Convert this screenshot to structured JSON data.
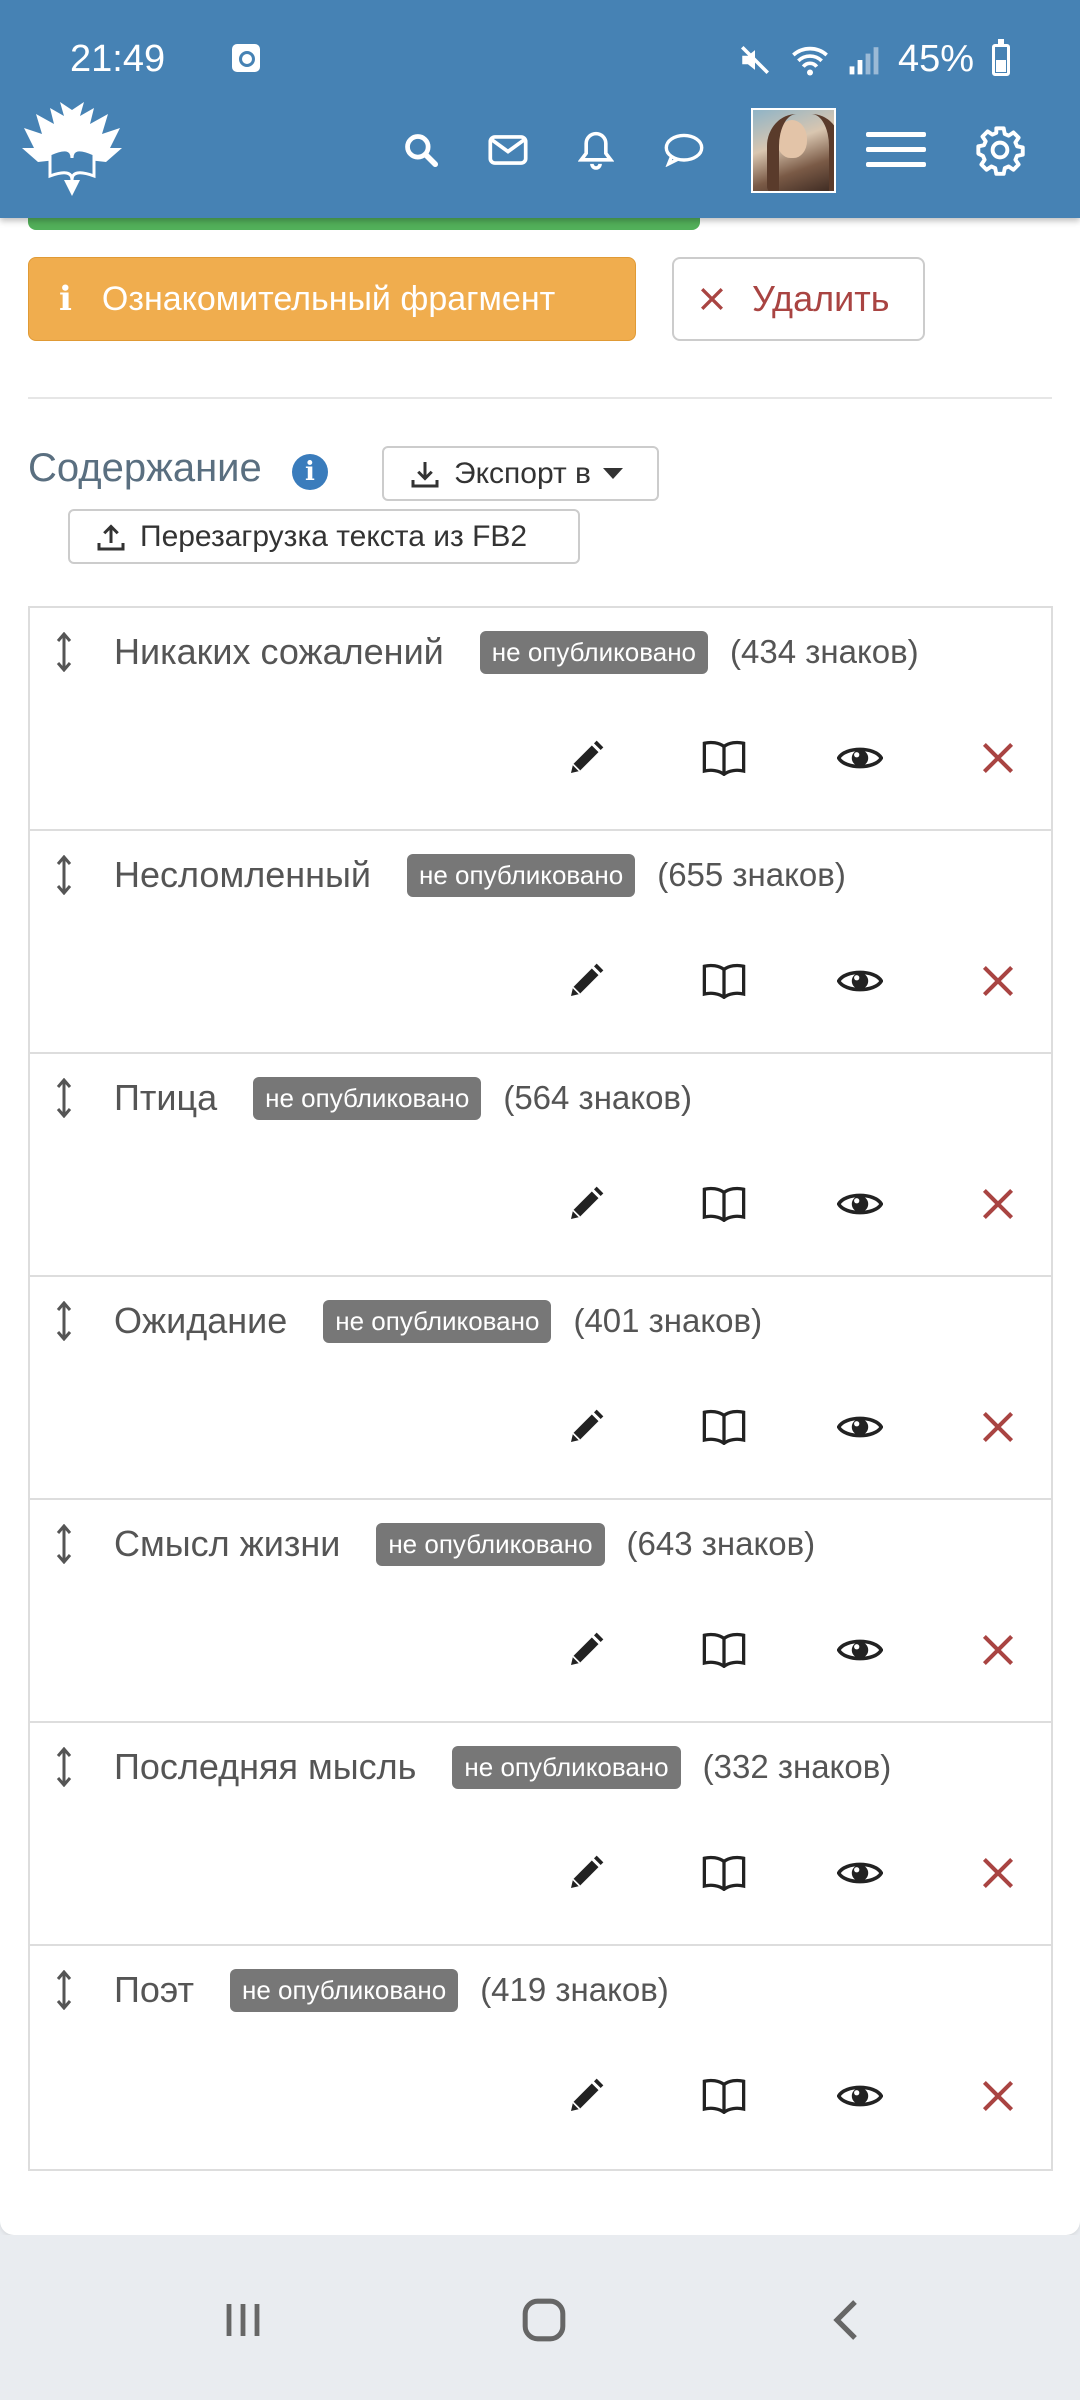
{
  "status_bar": {
    "time": "21:49",
    "battery": "45%"
  },
  "header": {
    "icons": [
      "logo-eagle-book",
      "search-icon",
      "mail-icon",
      "bell-icon",
      "chat-icon",
      "avatar",
      "hamburger-menu-icon",
      "gear-icon"
    ]
  },
  "actions": {
    "fragment_label": "Ознакомительный фрагмент",
    "delete_label": "Удалить"
  },
  "contents": {
    "title": "Содержание",
    "export_label": "Экспорт в",
    "reload_label": "Перезагрузка текста из FB2"
  },
  "chapters": [
    {
      "title": "Никаких сожалений",
      "status": "не опубликовано",
      "chars": "(434 знаков)"
    },
    {
      "title": "Несломленный",
      "status": "не опубликовано",
      "chars": "(655 знаков)"
    },
    {
      "title": "Птица",
      "status": "не опубликовано",
      "chars": "(564 знаков)"
    },
    {
      "title": "Ожидание",
      "status": "не опубликовано",
      "chars": "(401 знаков)"
    },
    {
      "title": "Смысл жизни",
      "status": "не опубликовано",
      "chars": "(643 знаков)"
    },
    {
      "title": "Последняя мысль",
      "status": "не опубликовано",
      "chars": "(332 знаков)"
    },
    {
      "title": "Поэт",
      "status": "не опубликовано",
      "chars": "(419 знаков)"
    }
  ],
  "colors": {
    "header_bg": "#4682b4",
    "fragment_btn": "#f0ad4e",
    "delete_red": "#a94442",
    "badge_bg": "#777777",
    "info_blue": "#3a7cbc",
    "green_strip": "#52b05a"
  }
}
